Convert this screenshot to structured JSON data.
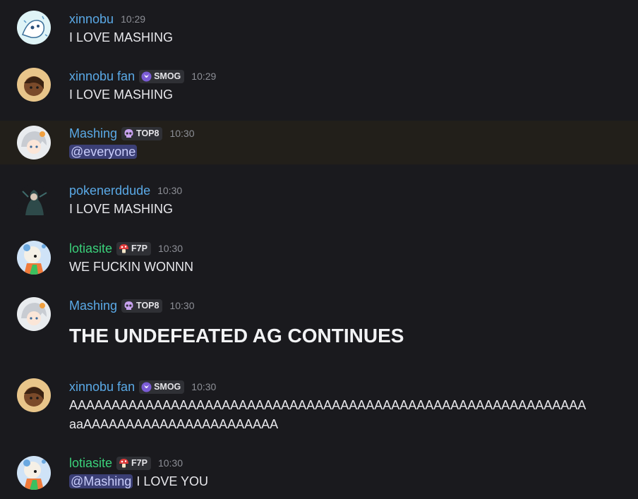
{
  "messages": [
    {
      "username": "xinnobu",
      "time": "10:29",
      "text": "I LOVE MASHING"
    },
    {
      "username": "xinnobu fan",
      "tag": "SMOG",
      "time": "10:29",
      "text": "I LOVE MASHING"
    },
    {
      "username": "Mashing",
      "tag": "TOP8",
      "time": "10:30",
      "mention": "@everyone"
    },
    {
      "username": "pokenerddude",
      "time": "10:30",
      "text": "I LOVE MASHING"
    },
    {
      "username": "lotiasite",
      "tag": "F7P",
      "time": "10:30",
      "text": "WE FUCKIN WONNN"
    },
    {
      "username": "Mashing",
      "tag": "TOP8",
      "time": "10:30",
      "text": "THE UNDEFEATED AG CONTINUES"
    },
    {
      "username": "xinnobu fan",
      "tag": "SMOG",
      "time": "10:30",
      "line1": "AAAAAAAAAAAAAAAAAAAAAAAAAAAAAAAAAAAAAAAAAAAAAAAAAAAAAAAAAAAAA",
      "line2": "aaAAAAAAAAAAAAAAAAAAAAAAA"
    },
    {
      "username": "lotiasite",
      "tag": "F7P",
      "time": "10:30",
      "mention": "@Mashing",
      "text": " I LOVE YOU"
    }
  ],
  "colors": {
    "background": "#1a1a1e",
    "highlight_background": "#221f1a",
    "username_blue": "#5aa9e6",
    "username_green": "#3ad07a",
    "mention_background": "#3b3f75",
    "mention_text": "#c9cdfb"
  },
  "icons": {
    "smog": "crescent-moon-icon",
    "top8": "skull-icon",
    "f7p": "mushroom-icon"
  }
}
